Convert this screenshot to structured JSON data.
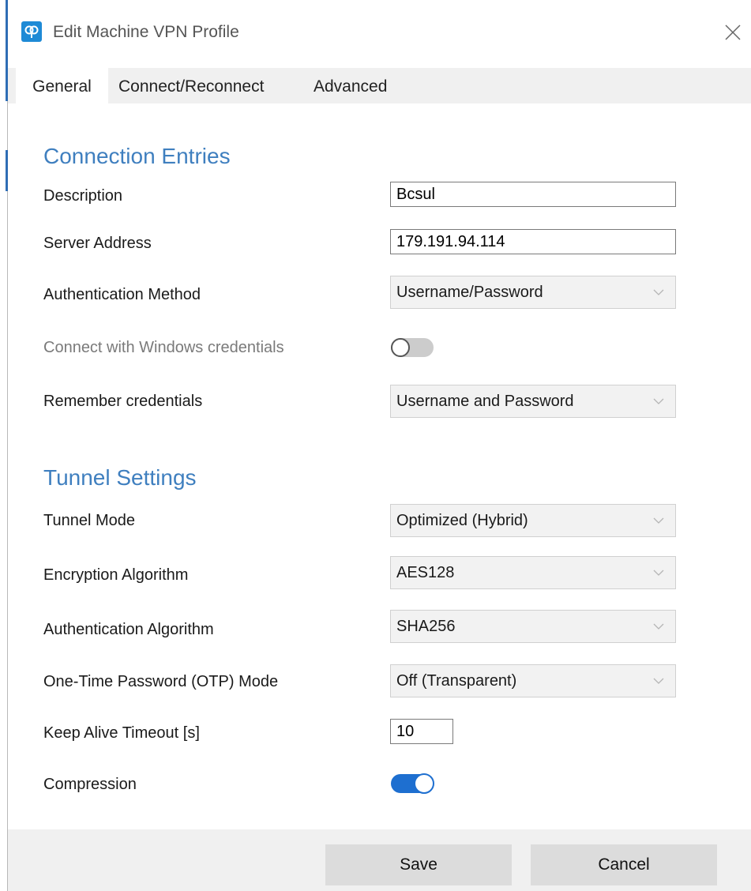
{
  "window": {
    "title": "Edit Machine VPN Profile"
  },
  "tabs": [
    {
      "label": "General",
      "active": true
    },
    {
      "label": "Connect/Reconnect",
      "active": false
    },
    {
      "label": "Advanced",
      "active": false
    }
  ],
  "connection": {
    "heading": "Connection Entries",
    "description": {
      "label": "Description",
      "value": "Bcsul"
    },
    "server_address": {
      "label": "Server Address",
      "value": "179.191.94.114"
    },
    "auth_method": {
      "label": "Authentication Method",
      "value": "Username/Password"
    },
    "windows_credentials": {
      "label": "Connect with Windows credentials",
      "enabled": false,
      "on": false
    },
    "remember_credentials": {
      "label": "Remember credentials",
      "value": "Username and Password"
    }
  },
  "tunnel": {
    "heading": "Tunnel Settings",
    "tunnel_mode": {
      "label": "Tunnel Mode",
      "value": "Optimized (Hybrid)"
    },
    "encryption": {
      "label": "Encryption Algorithm",
      "value": "AES128"
    },
    "authentication": {
      "label": "Authentication Algorithm",
      "value": "SHA256"
    },
    "otp_mode": {
      "label": "One-Time Password (OTP) Mode",
      "value": "Off (Transparent)"
    },
    "keep_alive": {
      "label": "Keep Alive Timeout [s]",
      "value": "10"
    },
    "compression": {
      "label": "Compression",
      "on": true
    }
  },
  "footer": {
    "save_label": "Save",
    "cancel_label": "Cancel"
  },
  "colors": {
    "accent": "#1e6fd0",
    "heading": "#3f7fbf",
    "icon": "#1e8ad6"
  },
  "icons": {
    "app": "vpn-key-icon",
    "close": "close-icon",
    "chevron": "chevron-down-icon"
  }
}
